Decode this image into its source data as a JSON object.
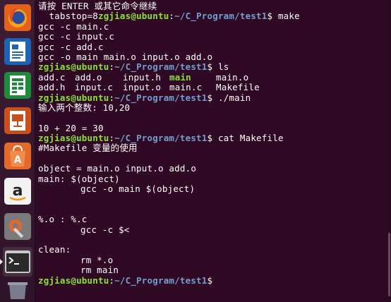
{
  "launcher": {
    "items": [
      {
        "name": "firefox-launcher",
        "icon": "firefox-icon"
      },
      {
        "name": "writer-launcher",
        "icon": "libreoffice-writer-icon"
      },
      {
        "name": "calc-launcher",
        "icon": "libreoffice-calc-icon"
      },
      {
        "name": "impress-launcher",
        "icon": "libreoffice-impress-icon"
      },
      {
        "name": "software-center-launcher",
        "icon": "ubuntu-software-icon"
      },
      {
        "name": "amazon-launcher",
        "icon": "amazon-icon"
      },
      {
        "name": "settings-launcher",
        "icon": "system-settings-icon"
      },
      {
        "name": "terminal-launcher",
        "icon": "terminal-icon",
        "active": true
      },
      {
        "name": "trash-launcher",
        "icon": "trash-icon"
      }
    ]
  },
  "terminal": {
    "colors": {
      "background": "#300a24",
      "text": "#ffffff",
      "user": "#8ae234",
      "path": "#729fcf",
      "exec": "#8ae234"
    },
    "prompt_user": "zgjias@ubuntu",
    "prompt_sep": ":",
    "prompt_path": "~/C_Program/test1",
    "prompt_suffix": "$",
    "line0": "请按 ENTER 或其它命令继续",
    "line1_pre": "  tabstop=8",
    "cmd_make": " make",
    "out_make": [
      "gcc -c main.c",
      "gcc -c input.c",
      "gcc -c add.c",
      "gcc -o main main.o input.o add.o"
    ],
    "cmd_ls": " ls",
    "ls_rows": [
      [
        "add.c",
        "add.o",
        "input.h",
        "main",
        "main.o"
      ],
      [
        "add.h",
        "input.c",
        "input.o",
        "main.c",
        "Makefile"
      ]
    ],
    "cmd_run": " ./main",
    "run_prompt": "输入两个整数: 10,20",
    "run_result": "10 + 20 = 30",
    "cmd_cat": " cat Makefile",
    "makefile": {
      "comment": "#Makefile 变量的使用",
      "object_line": "object = main.o input.o add.o",
      "main_target": "main: $(object)",
      "main_recipe": "gcc -o main $(object)",
      "pattern_target": "%.o : %.c",
      "pattern_recipe": "gcc -c $<",
      "clean_target": "clean:",
      "clean_recipe1": "rm *.o",
      "clean_recipe2": "rm main"
    }
  }
}
